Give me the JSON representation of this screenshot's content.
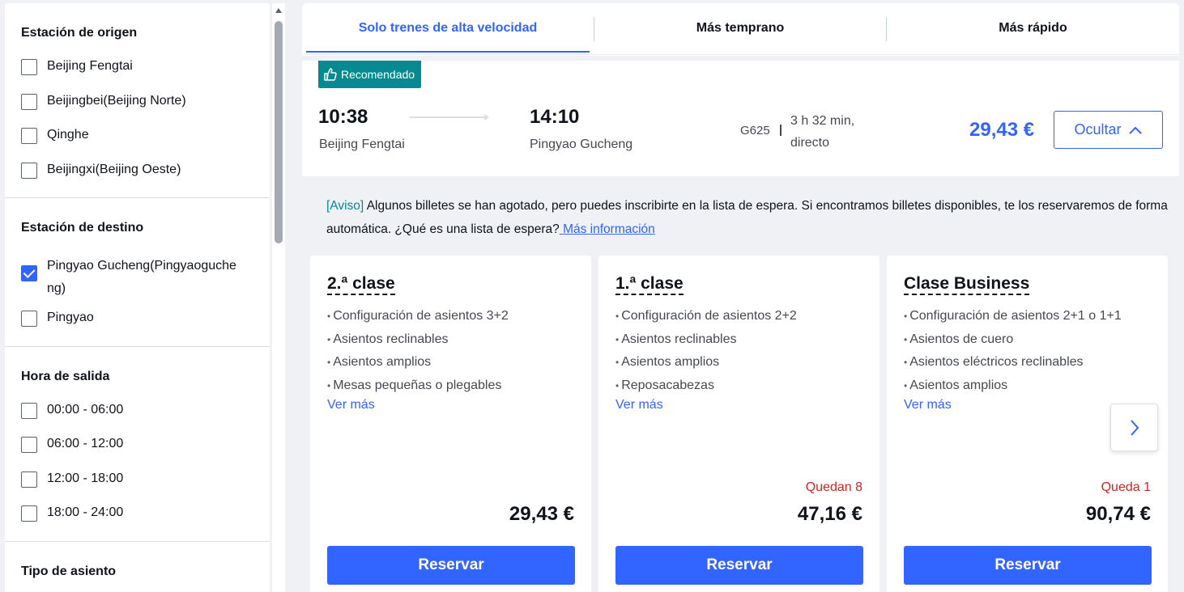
{
  "sidebar": {
    "origin": {
      "title": "Estación de origen",
      "options": [
        {
          "label": "Beijing Fengtai",
          "checked": false
        },
        {
          "label": "Beijingbei(Beijing Norte)",
          "checked": false
        },
        {
          "label": "Qinghe",
          "checked": false
        },
        {
          "label": "Beijingxi(Beijing Oeste)",
          "checked": false
        }
      ]
    },
    "destination": {
      "title": "Estación de destino",
      "options": [
        {
          "label": "Pingyao Gucheng(Pingyaoguche",
          "label2": "ng)",
          "checked": true
        },
        {
          "label": "Pingyao",
          "checked": false
        }
      ]
    },
    "departure": {
      "title": "Hora de salida",
      "options": [
        {
          "label": "00:00 - 06:00",
          "checked": false
        },
        {
          "label": "06:00 - 12:00",
          "checked": false
        },
        {
          "label": "12:00 - 18:00",
          "checked": false
        },
        {
          "label": "18:00 - 24:00",
          "checked": false
        }
      ]
    },
    "seat_type": {
      "title": "Tipo de asiento"
    }
  },
  "tabs": [
    {
      "label": "Solo trenes de alta velocidad",
      "active": true
    },
    {
      "label": "Más temprano",
      "active": false
    },
    {
      "label": "Más rápido",
      "active": false
    }
  ],
  "train": {
    "badge": "Recomendado",
    "depart_time": "10:38",
    "depart_station": "Beijing Fengtai",
    "arrive_time": "14:10",
    "arrive_station": "Pingyao Gucheng",
    "train_number": "G625",
    "duration_line1": "3 h 32 min,",
    "duration_line2": "directo",
    "price": "29,43 €",
    "hide_label": "Ocultar"
  },
  "notice": {
    "tag": "[Aviso]",
    "text": " Algunos billetes se han agotado, pero puedes inscribirte en la lista de espera. Si encontramos billetes disponibles, te los reservaremos de forma automática. ¿Qué es una lista de espera?",
    "link": " Más información"
  },
  "cards": [
    {
      "title": "2.ª clase",
      "features": [
        "Configuración de asientos 3+2",
        "Asientos reclinables",
        "Asientos amplios",
        "Mesas pequeñas o plegables"
      ],
      "more": "Ver más",
      "remaining": "",
      "price": "29,43 €",
      "button": "Reservar"
    },
    {
      "title": "1.ª clase",
      "features": [
        "Configuración de asientos 2+2",
        "Asientos reclinables",
        "Asientos amplios",
        "Reposacabezas"
      ],
      "more": "Ver más",
      "remaining": "Quedan 8",
      "price": "47,16 €",
      "button": "Reservar"
    },
    {
      "title": "Clase Business",
      "features": [
        "Configuración de asientos 2+1 o 1+1",
        "Asientos de cuero",
        "Asientos eléctricos reclinables",
        "Asientos amplios"
      ],
      "more": "Ver más",
      "remaining": "Queda 1",
      "price": "90,74 €",
      "button": "Reservar"
    }
  ],
  "colors": {
    "accent": "#3264ff",
    "badge": "#068a8f",
    "warning": "#d6221e"
  }
}
